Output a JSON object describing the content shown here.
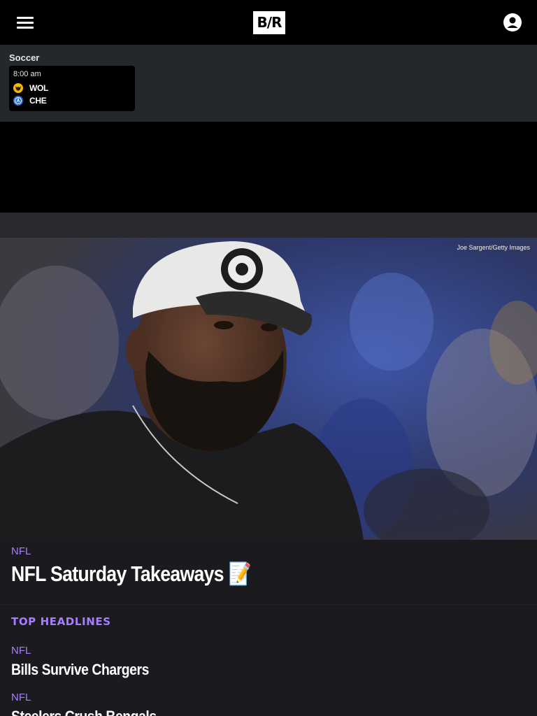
{
  "header": {
    "logo_text": "B/R",
    "menu_icon": "hamburger-menu-icon",
    "account_icon": "user-account-icon"
  },
  "scores": {
    "section_label": "Soccer",
    "game": {
      "time": "8:00 am",
      "teams": [
        {
          "abbr": "WOL",
          "crest_color": "#f5b800"
        },
        {
          "abbr": "CHE",
          "crest_color": "#2f6fd0"
        }
      ]
    }
  },
  "hero": {
    "photo_credit": "Joe Sargent/Getty Images"
  },
  "featured": {
    "tag": "NFL",
    "title": "NFL Saturday Takeaways 📝"
  },
  "top_headlines": {
    "section_title": "TOP HEADLINES",
    "items": [
      {
        "tag": "NFL",
        "title": "Bills Survive Chargers"
      },
      {
        "tag": "NFL",
        "title": "Steelers Crush Bengals"
      }
    ]
  },
  "colors": {
    "accent_purple": "#a67eff",
    "header_bg": "#000000",
    "scores_bg": "#24282c",
    "page_bg": "#1b1b1f"
  }
}
